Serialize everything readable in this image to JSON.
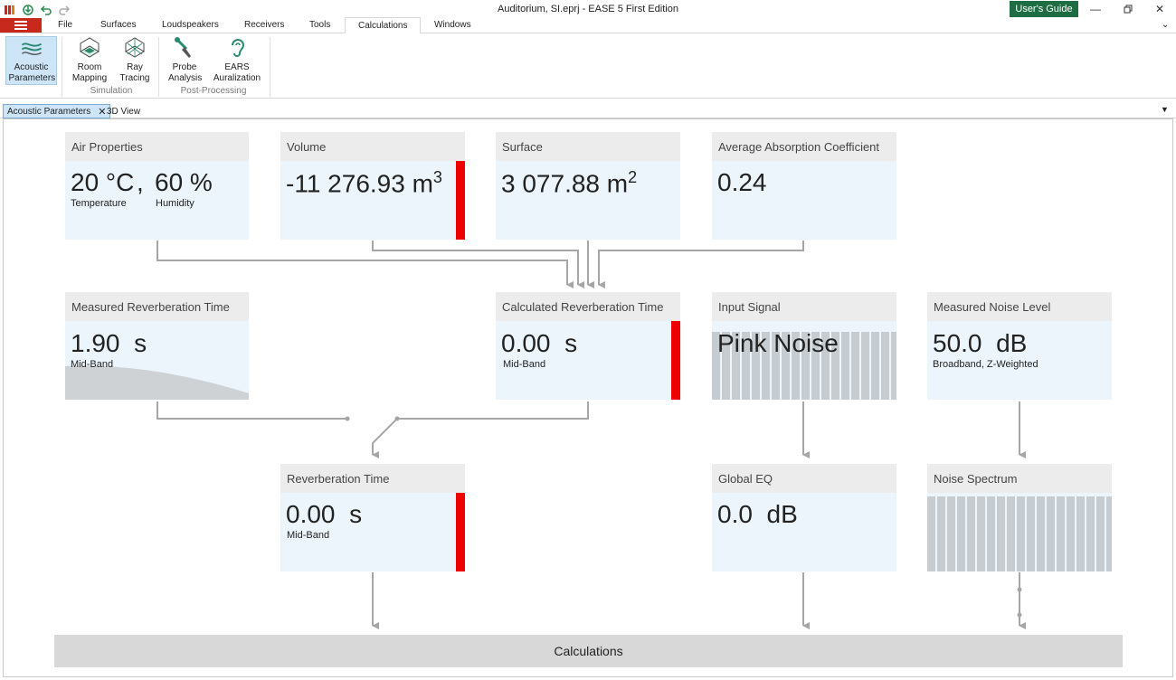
{
  "window": {
    "title": "Auditorium, SI.eprj - EASE 5 First Edition",
    "users_guide": "User's Guide"
  },
  "menu": {
    "tabs": [
      "File",
      "Surfaces",
      "Loudspeakers",
      "Receivers",
      "Tools",
      "Calculations",
      "Windows"
    ],
    "active": "Calculations"
  },
  "ribbon": {
    "acoustic_parameters": "Acoustic Parameters",
    "room_mapping": "Room Mapping",
    "ray_tracing": "Ray Tracing",
    "group_simulation": "Simulation",
    "probe_analysis": "Probe Analysis",
    "ears_auralization": "EARS Auralization",
    "group_post": "Post-Processing"
  },
  "doc_tabs": {
    "acoustic": "Acoustic Parameters",
    "view3d": "3D View"
  },
  "cards": {
    "air": {
      "title": "Air Properties",
      "temp_value": "20 °C",
      "comma": ",",
      "temp_label": "Temperature",
      "humidity_value": "60 %",
      "humidity_label": "Humidity"
    },
    "volume": {
      "title": "Volume",
      "value": "-11 276.93 m",
      "sup": "3"
    },
    "surface": {
      "title": "Surface",
      "value": "3 077.88 m",
      "sup": "2"
    },
    "absorption": {
      "title": "Average Absorption Coefficient",
      "value": "0.24"
    },
    "measured_rt": {
      "title": "Measured Reverberation Time",
      "value": "1.90",
      "unit": "s",
      "label": "Mid-Band"
    },
    "calculated_rt": {
      "title": "Calculated Reverberation Time",
      "value": "0.00",
      "unit": "s",
      "label": "Mid-Band"
    },
    "input_signal": {
      "title": "Input Signal",
      "value": "Pink Noise"
    },
    "measured_noise": {
      "title": "Measured Noise Level",
      "value": "50.0",
      "unit": "dB",
      "label": "Broadband, Z-Weighted"
    },
    "reverb_time": {
      "title": "Reverberation Time",
      "value": "0.00",
      "unit": "s",
      "label": "Mid-Band"
    },
    "global_eq": {
      "title": "Global EQ",
      "value": "0.0",
      "unit": "dB"
    },
    "noise_spectrum": {
      "title": "Noise Spectrum"
    }
  },
  "calculations_label": "Calculations",
  "colors": {
    "accent_red": "#ee0000",
    "brand_green": "#1f6e43",
    "app_red": "#c72a1c",
    "card_bg": "#ecf5fc",
    "card_header": "#ececec",
    "wire": "#a6a6a6"
  }
}
